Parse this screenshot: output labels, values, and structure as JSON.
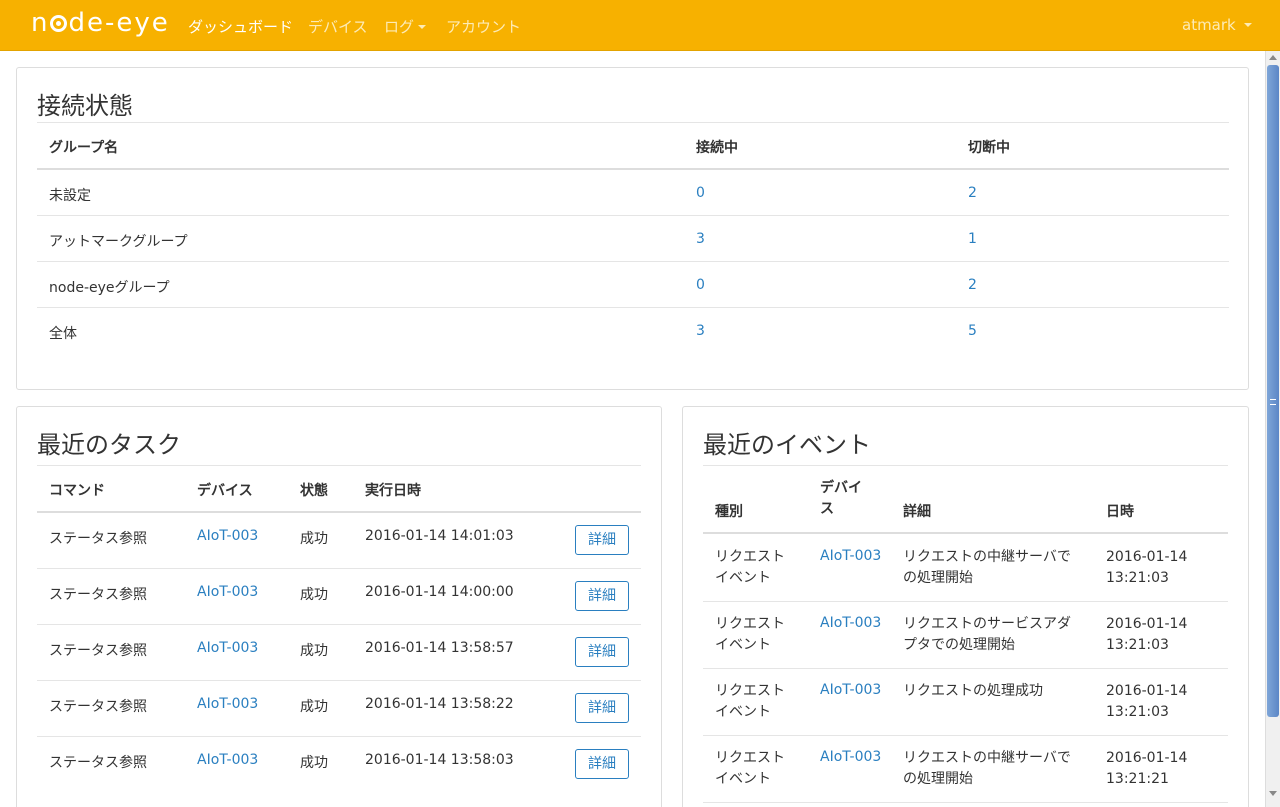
{
  "navbar": {
    "brand_left": "n",
    "brand_right": "de-eye",
    "items": [
      {
        "label": "ダッシュボード",
        "active": true
      },
      {
        "label": "デバイス",
        "active": false
      },
      {
        "label": "ログ",
        "active": false
      },
      {
        "label": "アカウント",
        "active": false
      }
    ],
    "user": "atmark"
  },
  "connection": {
    "title": "接続状態",
    "headers": [
      "グループ名",
      "接続中",
      "切断中"
    ],
    "rows": [
      [
        "未設定",
        "0",
        "2"
      ],
      [
        "アットマークグループ",
        "3",
        "1"
      ],
      [
        "node-eyeグループ",
        "0",
        "2"
      ],
      [
        "全体",
        "3",
        "5"
      ]
    ]
  },
  "tasks": {
    "title": "最近のタスク",
    "headers": [
      "コマンド",
      "デバイス",
      "状態",
      "実行日時"
    ],
    "button_label": "詳細",
    "rows": [
      [
        "ステータス参照",
        "AIoT-003",
        "成功",
        "2016-01-14 14:01:03"
      ],
      [
        "ステータス参照",
        "AIoT-003",
        "成功",
        "2016-01-14 14:00:00"
      ],
      [
        "ステータス参照",
        "AIoT-003",
        "成功",
        "2016-01-14 13:58:57"
      ],
      [
        "ステータス参照",
        "AIoT-003",
        "成功",
        "2016-01-14 13:58:22"
      ],
      [
        "ステータス参照",
        "AIoT-003",
        "成功",
        "2016-01-14 13:58:03"
      ]
    ]
  },
  "events": {
    "title": "最近のイベント",
    "headers": [
      "種別",
      "デバイス",
      "詳細",
      "日時"
    ],
    "header_device_l1": "デバイ",
    "header_device_l2": "ス",
    "rows": [
      {
        "type1": "リクエスト",
        "type2": "イベント",
        "device": "AIoT-003",
        "detail1": "リクエストの中継サーバで",
        "detail2": "の処理開始",
        "date": "2016-01-14",
        "time": "13:21:03"
      },
      {
        "type1": "リクエスト",
        "type2": "イベント",
        "device": "AIoT-003",
        "detail1": "リクエストのサービスアダ",
        "detail2": "プタでの処理開始",
        "date": "2016-01-14",
        "time": "13:21:03"
      },
      {
        "type1": "リクエスト",
        "type2": "イベント",
        "device": "AIoT-003",
        "detail1": "リクエストの処理成功",
        "detail2": "",
        "date": "2016-01-14",
        "time": "13:21:03"
      },
      {
        "type1": "リクエスト",
        "type2": "イベント",
        "device": "AIoT-003",
        "detail1": "リクエストの中継サーバで",
        "detail2": "の処理開始",
        "date": "2016-01-14",
        "time": "13:21:21"
      }
    ]
  }
}
